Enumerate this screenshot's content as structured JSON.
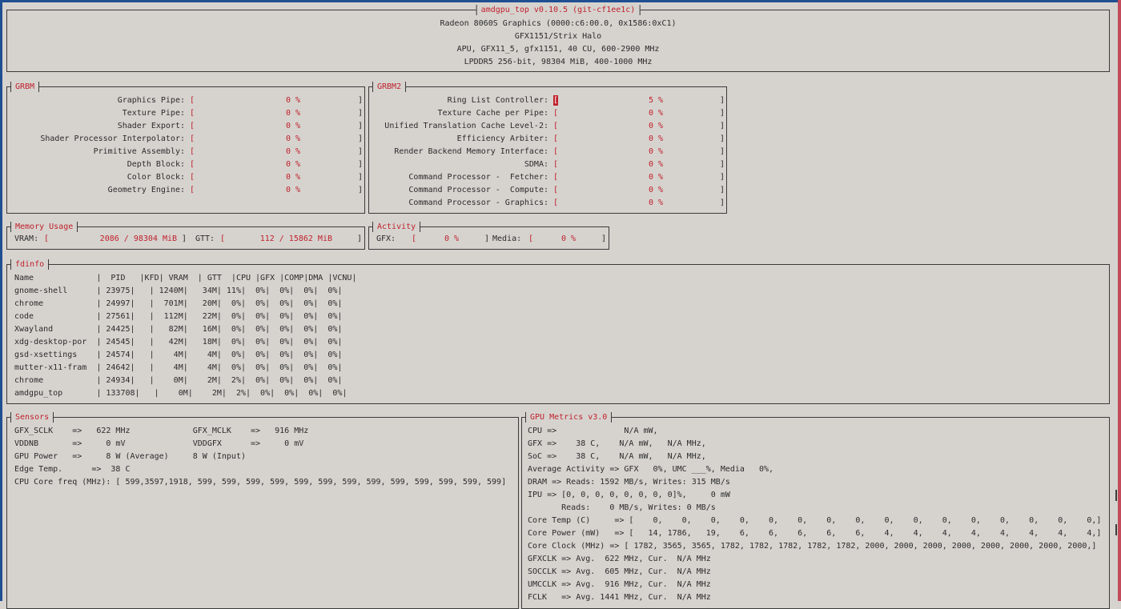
{
  "header": {
    "title": "amdgpu_top v0.10.5 (git-cf1ee1c)",
    "lines": [
      "Radeon 8060S Graphics (0000:c6:00.0, 0x1586:0xC1)",
      "GFX1151/Strix Halo",
      "APU, GFX11_5, gfx1151, 40 CU, 600-2900 MHz",
      "LPDDR5 256-bit, 98304 MiB, 400-1000 MHz"
    ]
  },
  "grbm": {
    "title": "GRBM",
    "rows": [
      {
        "label": "Graphics Pipe:",
        "value": "0 %"
      },
      {
        "label": "Texture Pipe:",
        "value": "0 %"
      },
      {
        "label": "Shader Export:",
        "value": "0 %"
      },
      {
        "label": "Shader Processor Interpolator:",
        "value": "0 %"
      },
      {
        "label": "Primitive Assembly:",
        "value": "0 %"
      },
      {
        "label": "Depth Block:",
        "value": "0 %"
      },
      {
        "label": "Color Block:",
        "value": "0 %"
      },
      {
        "label": "Geometry Engine:",
        "value": "0 %"
      }
    ]
  },
  "grbm2": {
    "title": "GRBM2",
    "rows": [
      {
        "label": "Ring List Controller:",
        "value": "5 %"
      },
      {
        "label": "Texture Cache per Pipe:",
        "value": "0 %"
      },
      {
        "label": "Unified Translation Cache Level-2:",
        "value": "0 %"
      },
      {
        "label": "Efficiency Arbiter:",
        "value": "0 %"
      },
      {
        "label": "Render Backend Memory Interface:",
        "value": "0 %"
      },
      {
        "label": "SDMA:",
        "value": "0 %"
      },
      {
        "label": "Command Processor -  Fetcher:",
        "value": "0 %"
      },
      {
        "label": "Command Processor -  Compute:",
        "value": "0 %"
      },
      {
        "label": "Command Processor - Graphics:",
        "value": "0 %"
      }
    ]
  },
  "memory": {
    "title": "Memory Usage",
    "vram_label": "VRAM:",
    "vram_value": "2086 / 98304 MiB",
    "gtt_label": "GTT:",
    "gtt_value": "112 / 15862 MiB"
  },
  "activity": {
    "title": "Activity",
    "gfx_label": "GFX:",
    "gfx_value": "0 %",
    "media_label": "Media:",
    "media_value": "0 %"
  },
  "fdinfo": {
    "title": "fdinfo",
    "header": "Name             |  PID   |KFD| VRAM  | GTT  |CPU |GFX |COMP|DMA |VCNU|",
    "rows": [
      "gnome-shell      | 23975|   | 1240M|   34M| 11%|  0%|  0%|  0%|  0%|",
      "chrome           | 24997|   |  701M|   20M|  0%|  0%|  0%|  0%|  0%|",
      "code             | 27561|   |  112M|   22M|  0%|  0%|  0%|  0%|  0%|",
      "Xwayland         | 24425|   |   82M|   16M|  0%|  0%|  0%|  0%|  0%|",
      "xdg-desktop-por  | 24545|   |   42M|   18M|  0%|  0%|  0%|  0%|  0%|",
      "gsd-xsettings    | 24574|   |    4M|    4M|  0%|  0%|  0%|  0%|  0%|",
      "mutter-x11-fram  | 24642|   |    4M|    4M|  0%|  0%|  0%|  0%|  0%|",
      "chrome           | 24934|   |    0M|    2M|  2%|  0%|  0%|  0%|  0%|",
      "amdgpu_top       | 133708|   |    0M|    2M|  2%|  0%|  0%|  0%|  0%|"
    ]
  },
  "sensors": {
    "title": "Sensors",
    "lines": [
      "GFX_SCLK    =>   622 MHz             GFX_MCLK    =>   916 MHz",
      "VDDNB       =>     0 mV              VDDGFX      =>     0 mV",
      "GPU Power   =>     8 W (Average)     8 W (Input)",
      "Edge Temp.      =>  38 C",
      "CPU Core freq (MHz): [ 599,3597,1918, 599, 599, 599, 599, 599, 599, 599, 599, 599, 599, 599, 599, 599]"
    ]
  },
  "gpu_metrics": {
    "title": "GPU Metrics v3.0",
    "lines": [
      "CPU =>              N/A mW,",
      "GFX =>    38 C,    N/A mW,   N/A MHz,",
      "SoC =>    38 C,    N/A mW,   N/A MHz,",
      "Average Activity => GFX   0%, UMC ___%, Media   0%,",
      "DRAM => Reads: 1592 MB/s, Writes: 315 MB/s",
      "IPU => [0, 0, 0, 0, 0, 0, 0, 0]%,     0 mW",
      "       Reads:    0 MB/s, Writes: 0 MB/s",
      "Core Temp (C)     => [    0,    0,    0,    0,    0,    0,    0,    0,    0,    0,    0,    0,    0,    0,    0,    0,]",
      "Core Power (mW)   => [   14, 1786,   19,    6,    6,    6,    6,    6,    4,    4,    4,    4,    4,    4,    4,    4,]",
      "Core Clock (MHz) => [ 1782, 3565, 3565, 1782, 1782, 1782, 1782, 1782, 2000, 2000, 2000, 2000, 2000, 2000, 2000, 2000,]",
      "GFXCLK => Avg.  622 MHz, Cur.  N/A MHz",
      "SOCCLK => Avg.  605 MHz, Cur.  N/A MHz",
      "UMCCLK => Avg.  916 MHz, Cur.  N/A MHz",
      "FCLK   => Avg. 1441 MHz, Cur.  N/A MHz"
    ]
  }
}
